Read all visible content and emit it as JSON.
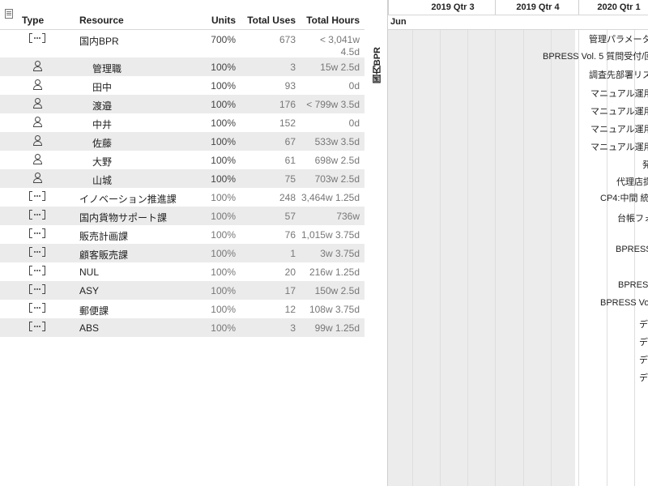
{
  "table": {
    "headers": {
      "type": "Type",
      "resource": "Resource",
      "units": "Units",
      "total_uses": "Total Uses",
      "total_hours": "Total Hours"
    },
    "rows": [
      {
        "kind": "group",
        "name": "国内BPR",
        "units": "700%",
        "uses": "673",
        "hours": "< 3,041w",
        "hours2": "4.5d"
      },
      {
        "kind": "person",
        "name": "管理職",
        "units": "100%",
        "uses": "3",
        "hours": "15w 2.5d"
      },
      {
        "kind": "person",
        "name": "田中",
        "units": "100%",
        "uses": "93",
        "hours": "0d"
      },
      {
        "kind": "person",
        "name": "渡邉",
        "units": "100%",
        "uses": "176",
        "hours": "< 799w 3.5d"
      },
      {
        "kind": "person",
        "name": "中井",
        "units": "100%",
        "uses": "152",
        "hours": "0d"
      },
      {
        "kind": "person",
        "name": "佐藤",
        "units": "100%",
        "uses": "67",
        "hours": "533w 3.5d"
      },
      {
        "kind": "person",
        "name": "大野",
        "units": "100%",
        "uses": "61",
        "hours": "698w 2.5d"
      },
      {
        "kind": "person",
        "name": "山城",
        "units": "100%",
        "uses": "75",
        "hours": "703w 2.5d"
      },
      {
        "kind": "group",
        "name": "イノベーション推進課",
        "units": "100%",
        "uses": "248",
        "hours": "3,464w 1.25d"
      },
      {
        "kind": "group",
        "name": "国内貨物サポート課",
        "units": "100%",
        "uses": "57",
        "hours": "736w"
      },
      {
        "kind": "group",
        "name": "販売計画課",
        "units": "100%",
        "uses": "76",
        "hours": "1,015w 3.75d"
      },
      {
        "kind": "group",
        "name": "顧客販売課",
        "units": "100%",
        "uses": "1",
        "hours": "3w 3.75d"
      },
      {
        "kind": "group",
        "name": "NUL",
        "units": "100%",
        "uses": "20",
        "hours": "216w 1.25d"
      },
      {
        "kind": "group",
        "name": "ASY",
        "units": "100%",
        "uses": "17",
        "hours": "150w 2.5d"
      },
      {
        "kind": "group",
        "name": "郵便課",
        "units": "100%",
        "uses": "12",
        "hours": "108w 3.75d"
      },
      {
        "kind": "group",
        "name": "ABS",
        "units": "100%",
        "uses": "3",
        "hours": "99w 1.25d"
      }
    ]
  },
  "gantt": {
    "vertical_label": "国内BPR",
    "quarters": [
      "2019 Qtr 3",
      "2019 Qtr 4",
      "2020 Qtr 1"
    ],
    "month": "Jun",
    "tasks": [
      "管理パラメータ",
      "BPRESS Vol. 5 質問受付/回",
      "調査先部署リス",
      "マニュアル運用",
      "マニュアル運用",
      "マニュアル運用",
      "マニュアル運用",
      "発",
      "代理店提",
      "CP4:中間 統",
      "台帳フォ",
      "BPRESS",
      "BPRESS",
      "BPRESS Vol",
      "デ",
      "デ",
      "デ",
      "デ"
    ]
  }
}
